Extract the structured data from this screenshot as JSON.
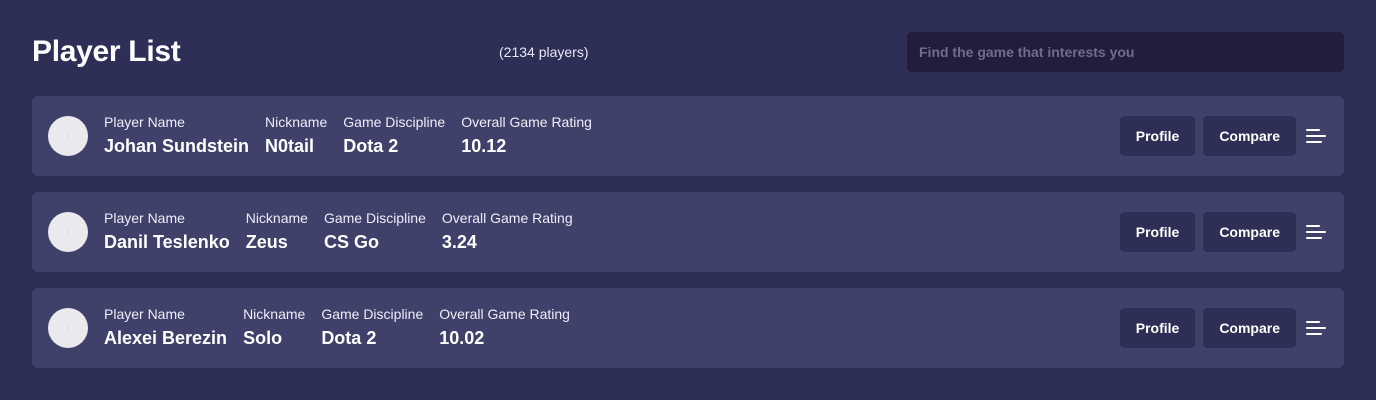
{
  "header": {
    "title": "Player List",
    "player_count": "(2134 players)",
    "search_placeholder": "Find the game that interests you"
  },
  "field_labels": {
    "player_name": "Player Name",
    "nickname": "Nickname",
    "game_discipline": "Game Discipline",
    "overall_rating": "Overall Game Rating"
  },
  "buttons": {
    "profile": "Profile",
    "compare": "Compare"
  },
  "players": [
    {
      "name": "Johan Sundstein",
      "nickname": "N0tail",
      "discipline": "Dota 2",
      "rating": "10.12"
    },
    {
      "name": "Danil Teslenko",
      "nickname": "Zeus",
      "discipline": "CS Go",
      "rating": "3.24"
    },
    {
      "name": "Alexei Berezin",
      "nickname": "Solo",
      "discipline": "Dota 2",
      "rating": "10.02"
    }
  ]
}
